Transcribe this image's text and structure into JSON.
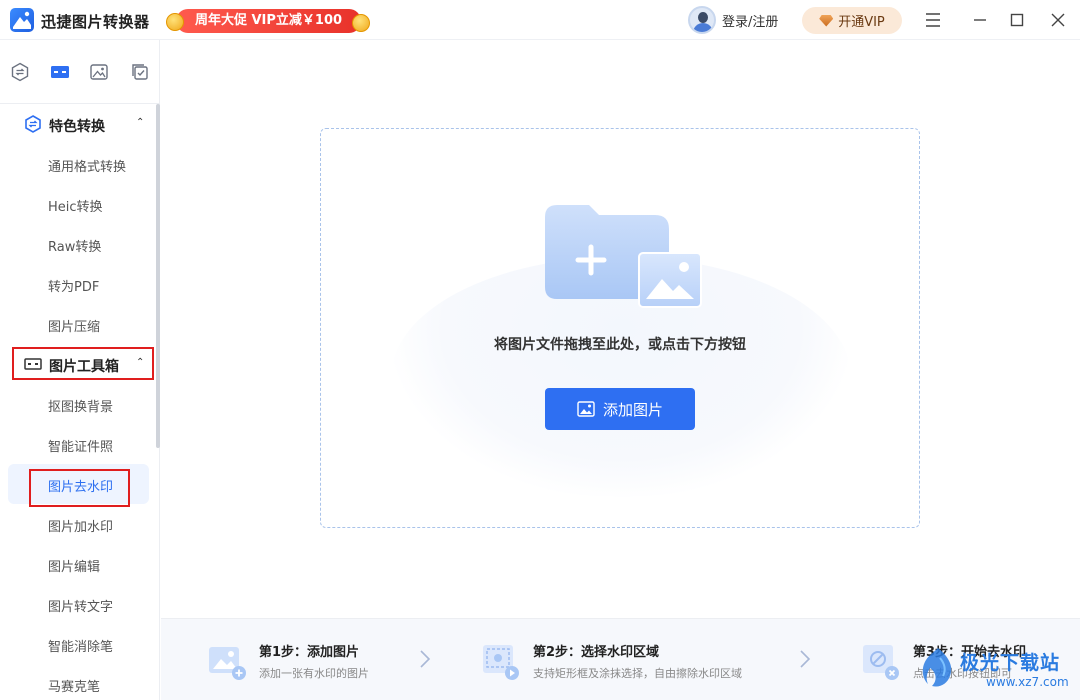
{
  "app": {
    "title": "迅捷图片转换器",
    "promo": "周年大促 VIP立减￥100",
    "login_label": "登录/注册",
    "vip_label": "开通VIP"
  },
  "sidebar": {
    "section1": {
      "label": "特色转换",
      "items": [
        "通用格式转换",
        "Heic转换",
        "Raw转换",
        "转为PDF",
        "图片压缩"
      ]
    },
    "section2": {
      "label": "图片工具箱",
      "items": [
        "抠图换背景",
        "智能证件照",
        "图片去水印",
        "图片加水印",
        "图片编辑",
        "图片转文字",
        "智能消除笔",
        "马赛克笔"
      ]
    },
    "active_item": "图片去水印"
  },
  "main": {
    "drop_hint": "将图片文件拖拽至此处，或点击下方按钮",
    "add_button": "添加图片"
  },
  "steps": [
    {
      "title": "第1步：添加图片",
      "desc": "添加一张有水印的图片"
    },
    {
      "title": "第2步：选择水印区域",
      "desc": "支持矩形框及涂抹选择，自由擦除水印区域"
    },
    {
      "title": "第3步：开始去水印",
      "desc": "点击去水印按钮即可"
    }
  ],
  "watermark": {
    "title": "极光下载站",
    "url": "www.xz7.com"
  },
  "colors": {
    "accent": "#2e6ff2",
    "highlight_box": "#e01e1e",
    "promo": "#e8322a"
  }
}
